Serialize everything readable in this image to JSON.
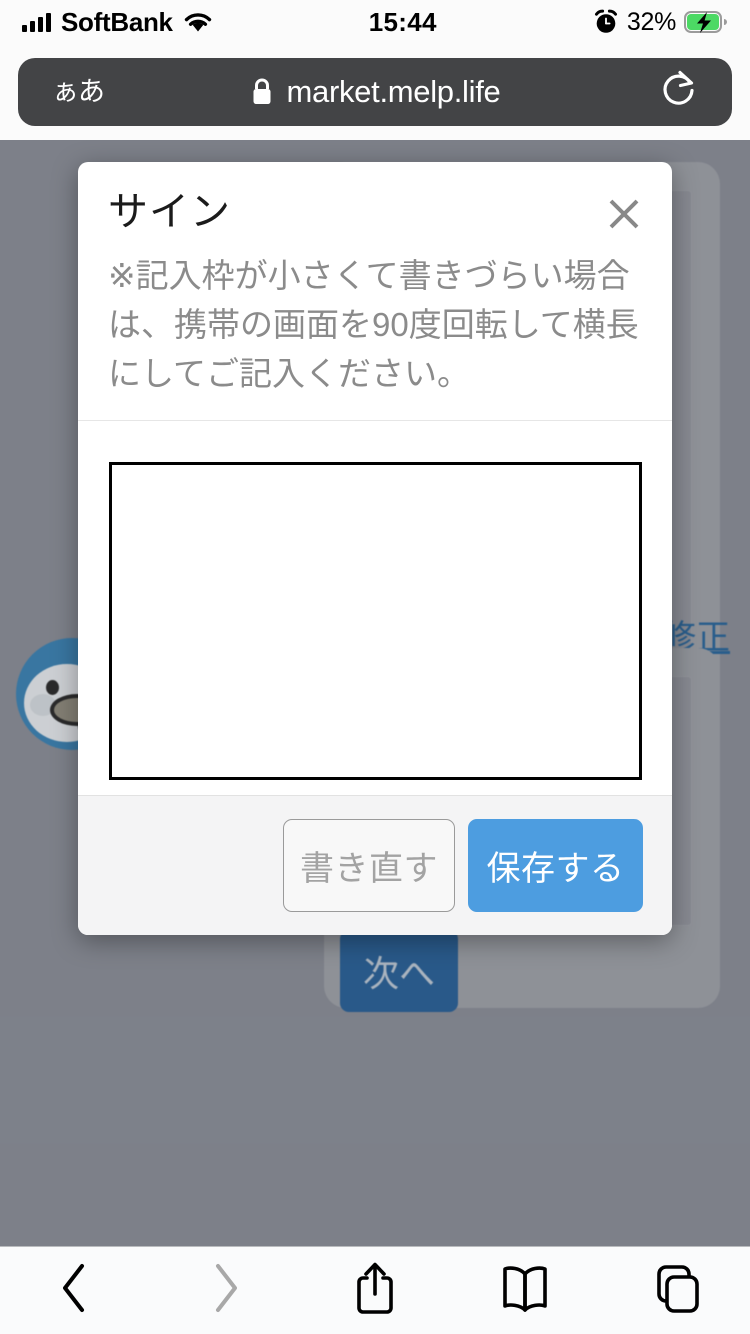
{
  "status_bar": {
    "carrier": "SoftBank",
    "signal_icon": "cellular-bars-icon",
    "wifi_icon": "wifi-icon",
    "time": "15:44",
    "alarm_icon": "alarm-clock-icon",
    "battery_percent": "32%",
    "battery_icon": "battery-charging-icon"
  },
  "browser": {
    "aa_button_label": "ぁあ",
    "lock_icon": "lock-icon",
    "url": "market.melp.life",
    "reload_icon": "reload-icon"
  },
  "modal": {
    "title": "サイン",
    "close_icon": "close-icon",
    "description": "※記入枠が小さくて書きづらい場合は、携帯の画面を90度回転して横長にしてご記入ください。",
    "canvas_name": "signature-canvas",
    "canvas_value": "",
    "buttons": {
      "clear_label": "書き直す",
      "save_label": "保存する"
    }
  },
  "page_background": {
    "next_button_label": "次へ",
    "edit_link_label": "修正",
    "avatar_icon": "penguin-avatar-icon"
  },
  "toolbar": {
    "back_icon": "chevron-left-icon",
    "forward_icon": "chevron-right-icon",
    "share_icon": "share-icon",
    "bookmarks_icon": "book-icon",
    "tabs_icon": "tabs-icon"
  },
  "colors": {
    "accent_blue": "#4d9de0",
    "next_button_blue": "#2a5f93",
    "link_blue": "#2a6496",
    "url_bar_bg": "#434446",
    "backdrop": "#878b94",
    "footer_bg": "#f4f4f5"
  }
}
